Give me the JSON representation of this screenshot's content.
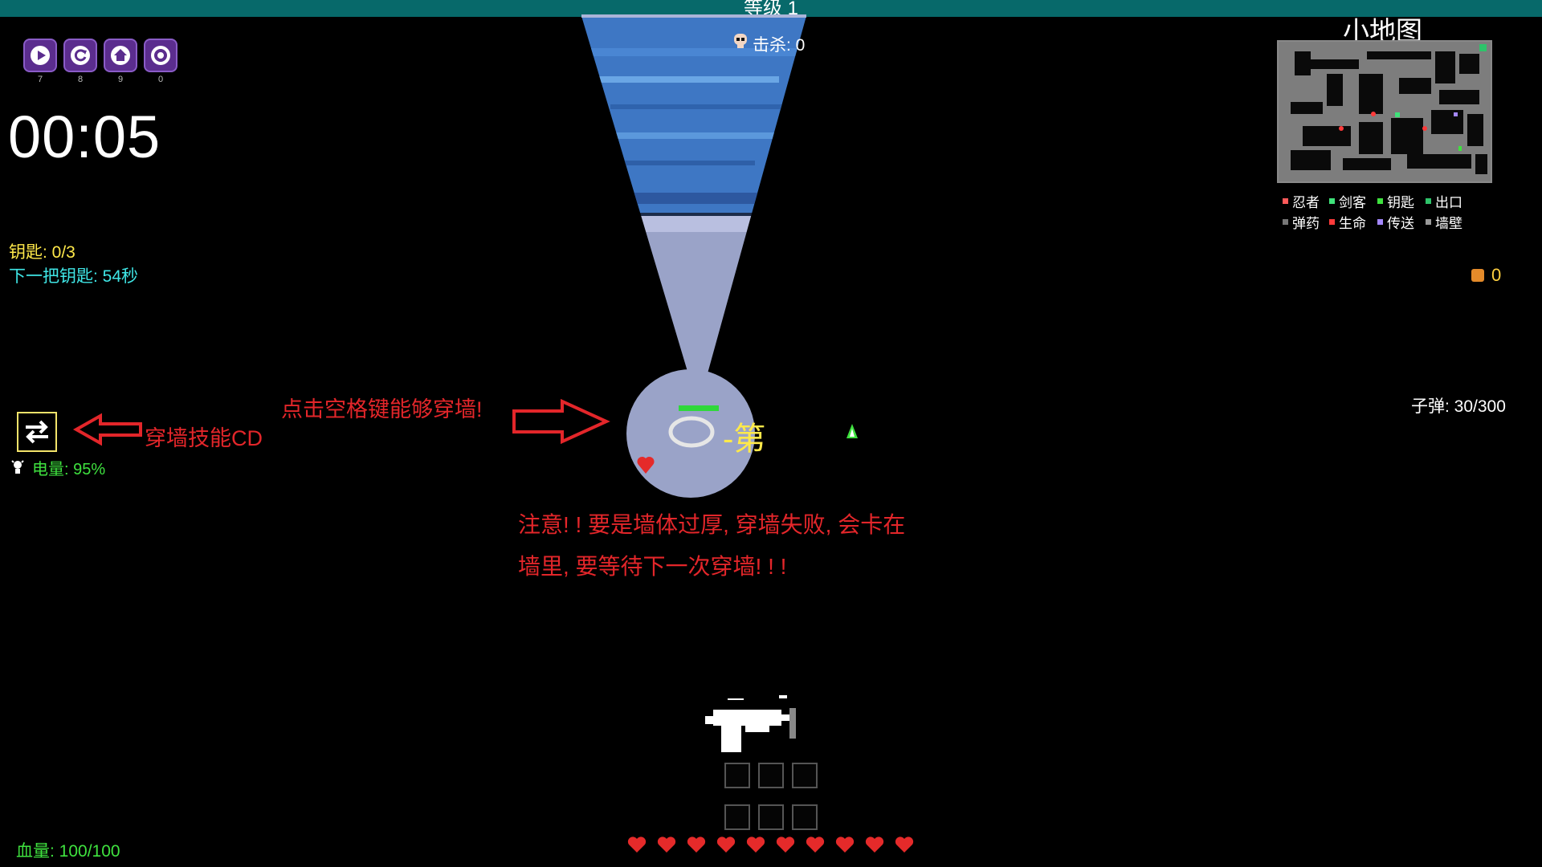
{
  "level": {
    "label": "等级 1"
  },
  "controls": [
    {
      "name": "play-button",
      "icon": "play-icon",
      "key": "7"
    },
    {
      "name": "restart-button",
      "icon": "restart-icon",
      "key": "8"
    },
    {
      "name": "home-button",
      "icon": "home-icon",
      "key": "9"
    },
    {
      "name": "settings-button",
      "icon": "gear-icon",
      "key": "0"
    }
  ],
  "timer": {
    "minutes": "00",
    "seconds": "05",
    "display": "00:05"
  },
  "keys": {
    "count": "钥匙: 0/3",
    "next": "下一把钥匙: 54秒"
  },
  "kills": {
    "label": "击杀: 0"
  },
  "skill": {
    "cd_label": "穿墙技能CD",
    "energy": "电量: 95%"
  },
  "hints": {
    "space": "点击空格键能够穿墙!",
    "warning_line1": "注意! ! 要是墙体过厚, 穿墙失败, 会卡在",
    "warning_line2": "墙里, 要等待下一次穿墙! ! !"
  },
  "minimap": {
    "title": "小地图",
    "legend": [
      {
        "label": "忍者",
        "color": "#ff5a5a"
      },
      {
        "label": "剑客",
        "color": "#3fe27a"
      },
      {
        "label": "钥匙",
        "color": "#3fe23f"
      },
      {
        "label": "出口",
        "color": "#2ec46a"
      },
      {
        "label": "弹药",
        "color": "#777777"
      },
      {
        "label": "生命",
        "color": "#ff3a3a"
      },
      {
        "label": "传送",
        "color": "#a488ff"
      },
      {
        "label": "墙壁",
        "color": "#9a9a9a"
      }
    ]
  },
  "coins": {
    "count": "0"
  },
  "ammo": {
    "label": "子弹: 30/300"
  },
  "health": {
    "label": "血量: 100/100",
    "hearts": 10
  },
  "floor_text": "-第",
  "colors": {
    "level_bar": "#07696a",
    "hint_red": "#e3262a",
    "energy_green": "#3fe23f",
    "key_yellow": "#ffe94a",
    "timer_cyan": "#3fe6e6"
  }
}
